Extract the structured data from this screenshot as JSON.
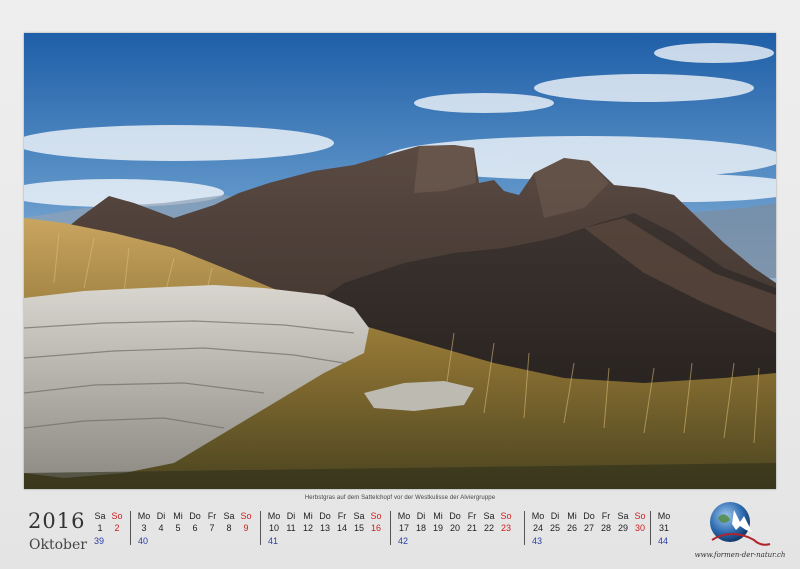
{
  "photo": {
    "caption": "Herbstgras auf dem Sattelchopf vor der Westkulisse der Alviergruppe"
  },
  "calendar": {
    "year": "2016",
    "month": "Oktober",
    "weeks": [
      {
        "kw": "39",
        "days": [
          {
            "name": "Sa",
            "date": "1",
            "sunday": false
          },
          {
            "name": "So",
            "date": "2",
            "sunday": true
          }
        ]
      },
      {
        "kw": "40",
        "days": [
          {
            "name": "Mo",
            "date": "3",
            "sunday": false
          },
          {
            "name": "Di",
            "date": "4",
            "sunday": false
          },
          {
            "name": "Mi",
            "date": "5",
            "sunday": false
          },
          {
            "name": "Do",
            "date": "6",
            "sunday": false
          },
          {
            "name": "Fr",
            "date": "7",
            "sunday": false
          },
          {
            "name": "Sa",
            "date": "8",
            "sunday": false
          },
          {
            "name": "So",
            "date": "9",
            "sunday": true
          }
        ]
      },
      {
        "kw": "41",
        "days": [
          {
            "name": "Mo",
            "date": "10",
            "sunday": false
          },
          {
            "name": "Di",
            "date": "11",
            "sunday": false
          },
          {
            "name": "Mi",
            "date": "12",
            "sunday": false
          },
          {
            "name": "Do",
            "date": "13",
            "sunday": false
          },
          {
            "name": "Fr",
            "date": "14",
            "sunday": false
          },
          {
            "name": "Sa",
            "date": "15",
            "sunday": false
          },
          {
            "name": "So",
            "date": "16",
            "sunday": true
          }
        ]
      },
      {
        "kw": "42",
        "days": [
          {
            "name": "Mo",
            "date": "17",
            "sunday": false
          },
          {
            "name": "Di",
            "date": "18",
            "sunday": false
          },
          {
            "name": "Mi",
            "date": "19",
            "sunday": false
          },
          {
            "name": "Do",
            "date": "20",
            "sunday": false
          },
          {
            "name": "Fr",
            "date": "21",
            "sunday": false
          },
          {
            "name": "Sa",
            "date": "22",
            "sunday": false
          },
          {
            "name": "So",
            "date": "23",
            "sunday": true
          }
        ]
      },
      {
        "kw": "43",
        "days": [
          {
            "name": "Mo",
            "date": "24",
            "sunday": false
          },
          {
            "name": "Di",
            "date": "25",
            "sunday": false
          },
          {
            "name": "Mi",
            "date": "26",
            "sunday": false
          },
          {
            "name": "Do",
            "date": "27",
            "sunday": false
          },
          {
            "name": "Fr",
            "date": "28",
            "sunday": false
          },
          {
            "name": "Sa",
            "date": "29",
            "sunday": false
          },
          {
            "name": "So",
            "date": "30",
            "sunday": true
          }
        ]
      },
      {
        "kw": "44",
        "days": [
          {
            "name": "Mo",
            "date": "31",
            "sunday": false
          }
        ]
      }
    ]
  },
  "branding": {
    "website": "www.formen-der-natur.ch",
    "logo_icon": "globe-mountain-icon"
  },
  "colors": {
    "sunday": "#cc1f1f",
    "week_number": "#2a3fa8",
    "text": "#222222"
  }
}
